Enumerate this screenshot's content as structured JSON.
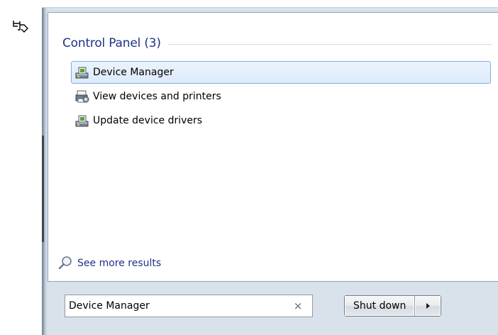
{
  "control_panel": {
    "title": "Control Panel (3)",
    "items": [
      {
        "label": "Device Manager",
        "icon": "device-manager-icon",
        "selected": true
      },
      {
        "label": "View devices and printers",
        "icon": "devices-printers-icon",
        "selected": false
      },
      {
        "label": "Update device drivers",
        "icon": "device-manager-icon",
        "selected": false
      }
    ]
  },
  "see_more": {
    "label": "See more results",
    "icon": "search-icon"
  },
  "search": {
    "value": "Device Manager",
    "clear_icon": "×"
  },
  "shutdown": {
    "label": "Shut down",
    "arrow_icon": "right-arrow-icon"
  },
  "colors": {
    "group_title": "#1e3287",
    "selection_border": "#84acdd",
    "selection_fill": "#dcebfb"
  }
}
